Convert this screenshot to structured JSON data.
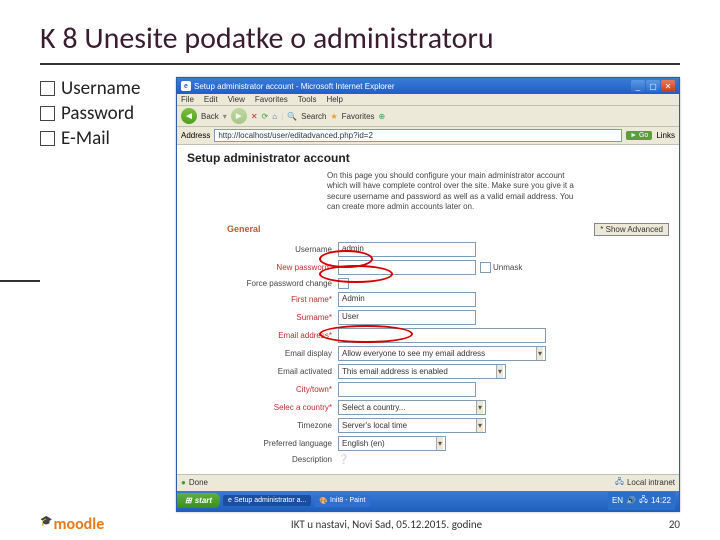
{
  "slide": {
    "title": "K 8 Unesite podatke o administratoru",
    "bullets": [
      "Username",
      "Password",
      "E-Mail"
    ]
  },
  "ie": {
    "title": "Setup administrator account - Microsoft Internet Explorer",
    "menu": [
      "File",
      "Edit",
      "View",
      "Favorites",
      "Tools",
      "Help"
    ],
    "toolbar": {
      "back": "Back",
      "search": "Search",
      "favorites": "Favorites"
    },
    "address_label": "Address",
    "address_url": "http://localhost/user/editadvanced.php?id=2",
    "go": "Go",
    "links": "Links"
  },
  "page": {
    "h1": "Setup administrator account",
    "desc": "On this page you should configure your main administrator account which will have complete control over the site. Make sure you give it a secure username and password as well as a valid email address. You can create more admin accounts later on.",
    "general": "General",
    "show_advanced": "* Show Advanced",
    "fields": {
      "username_label": "Username",
      "username_value": "admin",
      "newpass_label": "New password*",
      "unmask": "Unmask",
      "force_label": "Force password change",
      "firstname_label": "First name*",
      "firstname_value": "Admin",
      "surname_label": "Surname*",
      "surname_value": "User",
      "email_label": "Email address*",
      "emaildisp_label": "Email display",
      "emaildisp_value": "Allow everyone to see my email address",
      "emailact_label": "Email activated",
      "emailact_value": "This email address is enabled",
      "city_label": "City/town*",
      "country_label": "Selec a country*",
      "country_value": "Select a country...",
      "tz_label": "Timezone",
      "tz_value": "Server's local time",
      "lang_label": "Preferred language",
      "lang_value": "English (en)",
      "descr_label": "Description"
    },
    "status_done": "Done",
    "status_intranet": "Local intranet"
  },
  "taskbar": {
    "start": "start",
    "items": [
      "Setup administrator a...",
      "Init8 - Paint"
    ],
    "tray_lang": "EN",
    "tray_time": "14:22"
  },
  "footer": {
    "logo": "moodle",
    "center": "IKT u nastavi, Novi Sad, 05.12.2015. godine",
    "page": "20"
  }
}
